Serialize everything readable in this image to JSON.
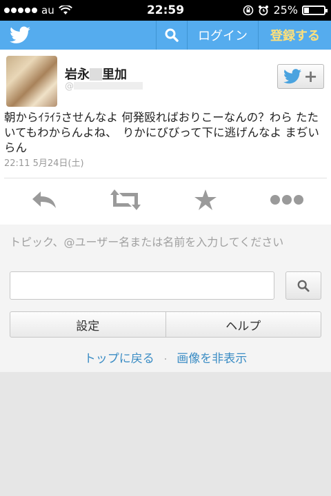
{
  "status_bar": {
    "carrier": "au",
    "time": "22:59",
    "battery": "25%",
    "battery_level": 0.25
  },
  "nav": {
    "login": "ログイン",
    "signup": "登録する"
  },
  "tweet": {
    "name": "岩永",
    "name_suffix": "里加",
    "handle": "@",
    "text": "朝からｲﾗｲﾗさせんなよ 何発殴ればおりこーなんの？わら たたいてもわからんよね、　りかにびびって下に逃げんなよ まぢいらん",
    "timestamp": "22:11 5月24日(土)"
  },
  "search": {
    "hint": "トピック、@ユーザー名または名前を入力してください",
    "value": ""
  },
  "buttons": {
    "settings": "設定",
    "help": "ヘルプ"
  },
  "footer_links": {
    "top": "トップに戻る",
    "separator": "·",
    "hide_images": "画像を非表示"
  },
  "colors": {
    "brand": "#55acee",
    "signup": "#ffe07a",
    "link": "#3a8cc4"
  }
}
